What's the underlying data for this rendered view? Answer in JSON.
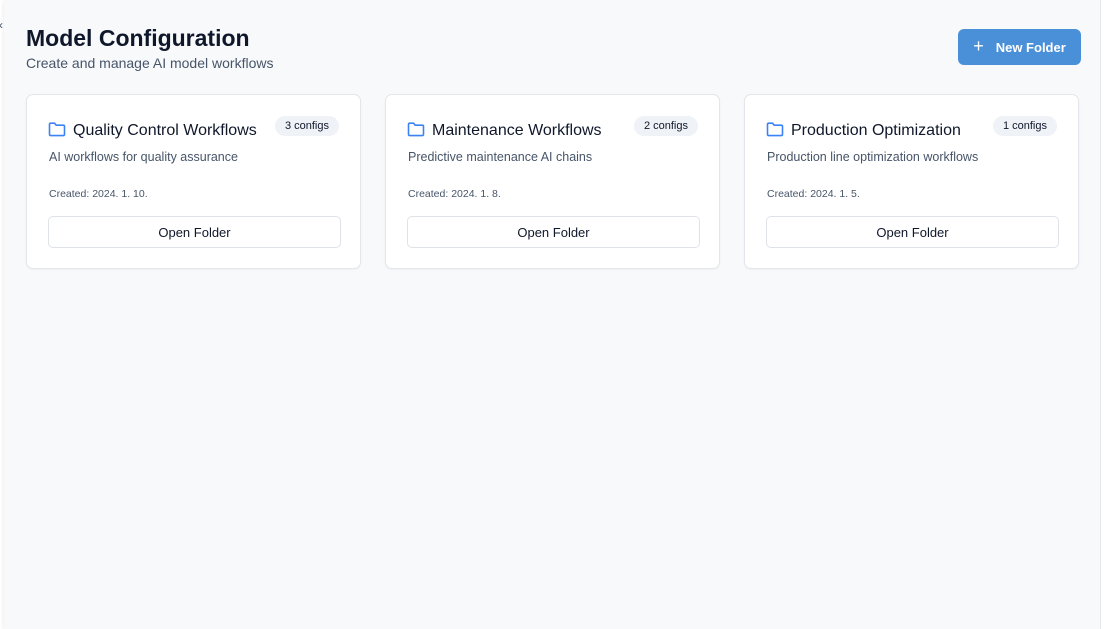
{
  "header": {
    "title": "Model Configuration",
    "subtitle": "Create and manage AI model workflows",
    "new_folder_label": "New Folder",
    "new_folder_icon": "plus-icon",
    "collapse_glyph": "‹"
  },
  "colors": {
    "accent": "#4a90d9",
    "folder_icon": "#3b82f6",
    "background": "#f8f9fb",
    "card_border": "#e3e6ea",
    "badge_background": "#eff2f6"
  },
  "folders": [
    {
      "icon": "folder-icon",
      "title": "Quality Control Workflows",
      "badge": "3 configs",
      "description": "AI workflows for quality assurance",
      "created": "Created: 2024. 1. 10.",
      "button_label": "Open Folder"
    },
    {
      "icon": "folder-icon",
      "title": "Maintenance Workflows",
      "badge": "2 configs",
      "description": "Predictive maintenance AI chains",
      "created": "Created: 2024. 1. 8.",
      "button_label": "Open Folder"
    },
    {
      "icon": "folder-icon",
      "title": "Production Optimization",
      "badge": "1 configs",
      "description": "Production line optimization workflows",
      "created": "Created: 2024. 1. 5.",
      "button_label": "Open Folder"
    }
  ]
}
